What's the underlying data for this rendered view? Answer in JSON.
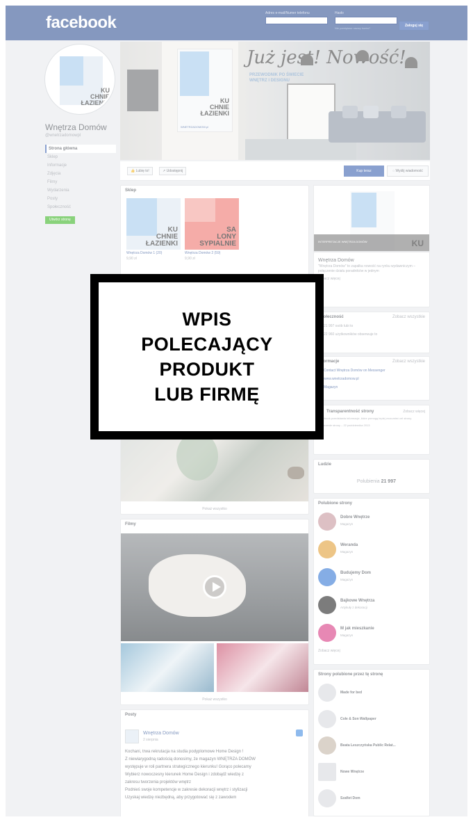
{
  "header": {
    "logo": "facebook",
    "email_label": "Adres e-mail/Numer telefonu",
    "password_label": "Hasło",
    "forgot_link": "Nie pamiętasz nazwy konta?",
    "login_button": "Zaloguj się"
  },
  "page": {
    "name": "Wnętrza Domów",
    "handle": "@wnetrzadomowpl",
    "nav": [
      "Strona główna",
      "Sklep",
      "Informacje",
      "Zdjęcia",
      "Filmy",
      "Wydarzenia",
      "Posty",
      "Społeczność"
    ],
    "create_button": "Utwórz stronę"
  },
  "cover": {
    "script_text": "Już jest! Nowość!",
    "subtitle_lines": [
      "PRZEWODNIK PO ŚWIECIE",
      "WNĘTRZ I DESIGNU"
    ],
    "magazine_title": [
      "KU",
      "CHNIE",
      "ŁAZIENKI"
    ],
    "magazine_site": "WNETRZADOMOW.pl"
  },
  "actions": {
    "like": "Lubię to!",
    "share": "Udostępnij",
    "buy": "Kup teraz",
    "message": "Wyślij wiadomość"
  },
  "shop": {
    "title": "Sklep",
    "items": [
      {
        "caption": "Wnętrza Domów 1 (20)",
        "price": "9,90 zł",
        "cover": [
          "KU",
          "CHNIE",
          "ŁAZIENKI"
        ],
        "color": "#a8cdee"
      },
      {
        "caption": "Wnętrza Domów 2 (59)",
        "price": "9,90 zł",
        "cover": [
          "SA",
          "LONY",
          "SYPIALNIE"
        ],
        "color": "#ef7a73"
      }
    ]
  },
  "photos": {
    "see_all": "Pokaż wszystko"
  },
  "films": {
    "title": "Filmy",
    "see_all": "Pokaż wszystko"
  },
  "posts": {
    "title": "Posty",
    "author": "Wnętrza Domów",
    "date": "2 sierpnia",
    "lines": [
      "Kochani, trwa rekrutacja na studia podyplomowe Home Design !",
      "Z niewiarygodną radością donosimy, że magazyn WNĘTRZA DOMÓW",
      "występuje w roli partnera strategicznego kierunku! Gorąco polecamy",
      "Wybierz nowoczesny kierunek Home Design i zdobądź wiedzę z",
      "zakresu tworzenia projektów wnętrz",
      "Podnieś swoje kompetencje w zakresie dekoracji wnętrz i stylizacji",
      "Uzyskaj wiedzę niezbędną, aby przygotować się z zawodem"
    ]
  },
  "sidebar": {
    "book_band": "INTERPRETACJE WNĘTRZA DOMÓW",
    "book_corner": "KU",
    "about_name": "Wnętrza Domów",
    "about_desc": "\"Wnętrza Domów\" to zapałka nowość na rynku wydawniczym – połączenie działu poradników w jednym",
    "about_more": "Zobacz więcej",
    "community_title": "Społeczność",
    "community_link": "Zobacz wszystkie",
    "community_rows": [
      "21 997 osób lubi to",
      "22 960 użytkowników obserwuje to"
    ],
    "info_title": "Informacje",
    "info_link": "Zobacz wszystkie",
    "info_rows": [
      "Contact Wnętrza Domów on Messenger",
      "www.wnetrzadomow.pl",
      "Magazyn"
    ],
    "trans_title": "Transparentność strony",
    "trans_link": "Zobacz więcej",
    "trans_text": "Facebook przedstawia informacje, które pomogą lepiej zrozumieć cel strony.",
    "trans_date": "Utworzenie strony – 22 października 2013",
    "people_title": "Ludzie",
    "people_count_label": "Polubienia",
    "people_count": "21 997",
    "liked_title": "Polubione strony",
    "liked": [
      {
        "name": "Dobre Wnętrze",
        "sub": "Magazyn",
        "color": "#c99aa0"
      },
      {
        "name": "Weranda",
        "sub": "Magazyn",
        "color": "#e2a23c"
      },
      {
        "name": "Budujemy Dom",
        "sub": "Magazyn",
        "color": "#3b7bd6"
      },
      {
        "name": "Bajkowe Wnętrza",
        "sub": "Artykuły z dekoracji",
        "color": "#2d2d2d"
      },
      {
        "name": "M jak mieszkanie",
        "sub": "Magazyn",
        "color": "#d83f87"
      }
    ],
    "liked_more": "Zobacz więcej",
    "ads_title": "Strony polubione przez tę stronę",
    "ads": [
      "Made for bed",
      "Cole & Son Wallpaper",
      "Beata Leszczyńska Public Relat...",
      "Nowe Wnętrze",
      "Szafiet Dom"
    ]
  },
  "overlay": {
    "lines": [
      "WPIS",
      "POLECAJĄCY",
      "PRODUKT",
      "LUB FIRMĘ"
    ]
  }
}
